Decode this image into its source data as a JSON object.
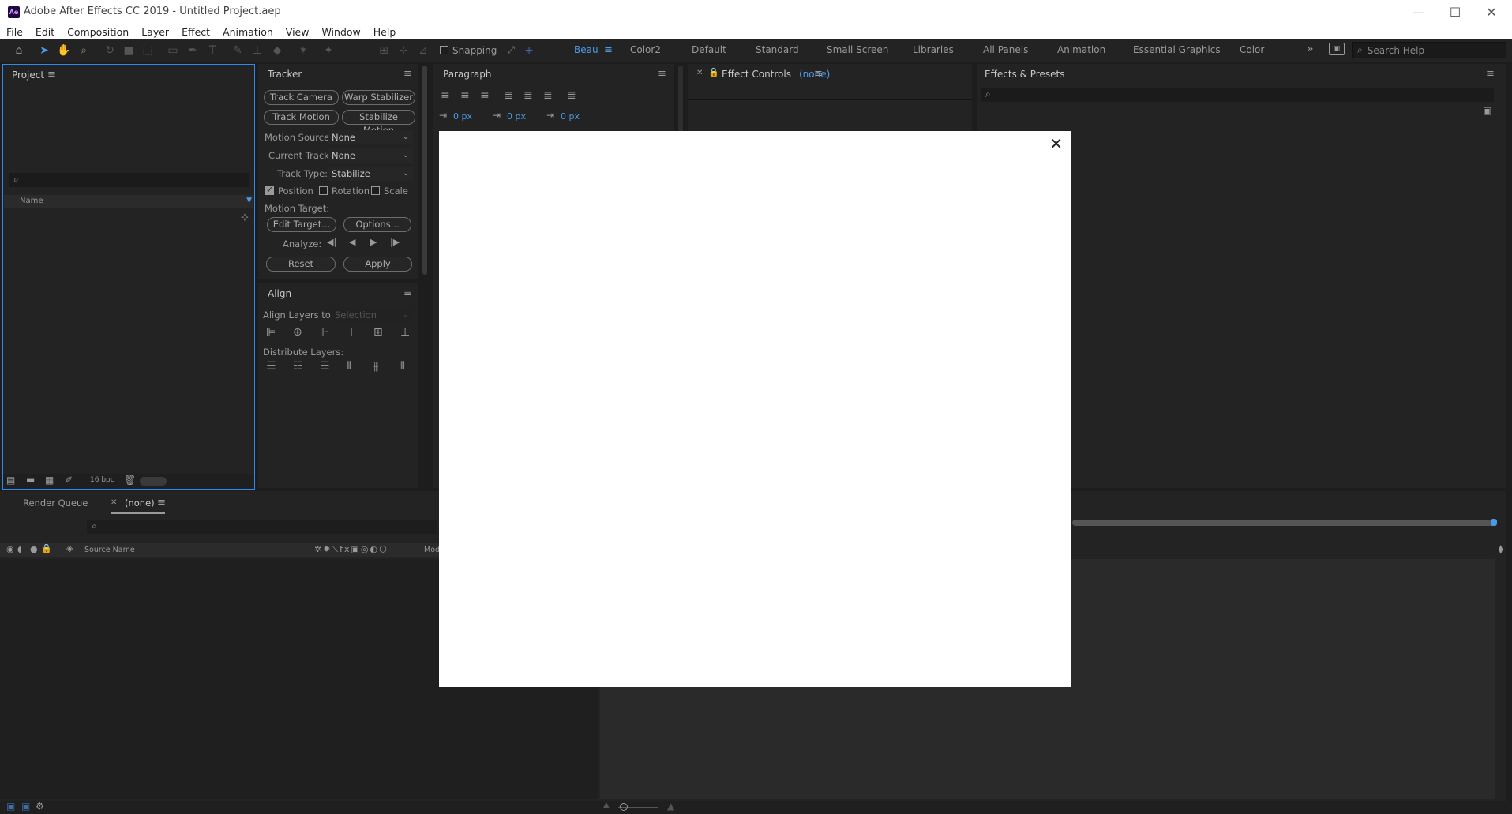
{
  "window": {
    "title": "Adobe After Effects CC 2019 - Untitled Project.aep",
    "app_icon_text": "Ae",
    "minimize": "—",
    "maximize": "☐",
    "close": "✕"
  },
  "menu": [
    "File",
    "Edit",
    "Composition",
    "Layer",
    "Effect",
    "Animation",
    "View",
    "Window",
    "Help"
  ],
  "toolbar": {
    "snapping_label": "Snapping",
    "workspaces": [
      "Beau",
      "Color2",
      "Default",
      "Standard",
      "Small Screen",
      "Libraries",
      "All Panels",
      "Animation",
      "Essential Graphics",
      "Color"
    ],
    "active_workspace": "Beau",
    "more": "»",
    "search_help_placeholder": "Search Help"
  },
  "project_panel": {
    "tab": "Project",
    "column_name": "Name",
    "bpc": "16 bpc"
  },
  "tracker_panel": {
    "tab": "Tracker",
    "track_camera": "Track Camera",
    "warp_stabilizer": "Warp Stabilizer",
    "track_motion": "Track Motion",
    "stabilize_motion": "Stabilize Motion",
    "motion_source_label": "Motion Source:",
    "motion_source_value": "None",
    "current_track_label": "Current Track:",
    "current_track_value": "None",
    "track_type_label": "Track Type:",
    "track_type_value": "Stabilize",
    "position": "Position",
    "rotation": "Rotation",
    "scale": "Scale",
    "motion_target_label": "Motion Target:",
    "edit_target": "Edit Target...",
    "options": "Options...",
    "analyze_label": "Analyze:",
    "reset": "Reset",
    "apply": "Apply"
  },
  "align_panel": {
    "tab": "Align",
    "align_layers_to_label": "Align Layers to:",
    "align_layers_to_value": "Selection",
    "distribute_label": "Distribute Layers:"
  },
  "paragraph_panel": {
    "tab": "Paragraph",
    "indent_left": "0 px",
    "space_before": "0 px",
    "indent_first": "0 px"
  },
  "effect_controls": {
    "tab": "Effect Controls",
    "target": "(none)"
  },
  "effects_presets": {
    "tab": "Effects & Presets"
  },
  "timeline": {
    "render_queue_tab": "Render Queue",
    "comp_tab": "(none)",
    "source_name": "Source Name",
    "mode": "Mod"
  },
  "colors": {
    "accent": "#4b9ae8",
    "panel_bg": "#232323",
    "frame_bg": "#1d1d1d"
  }
}
